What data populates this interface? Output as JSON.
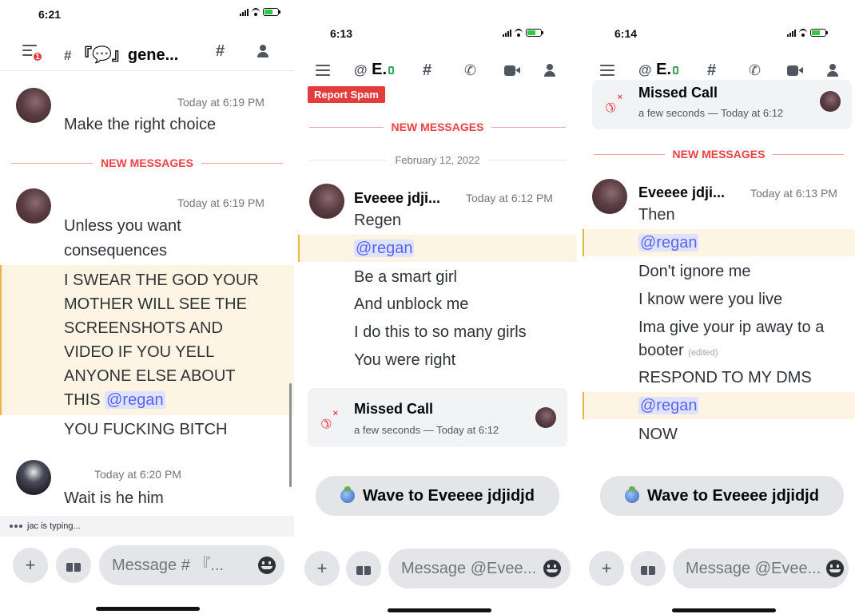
{
  "colors": {
    "mention": "#5865f2",
    "new_messages": "#ed4245",
    "highlight": "#fdf4e3",
    "report_spam": "#e23c3c"
  },
  "screen1": {
    "status": {
      "time": "6:21"
    },
    "header": {
      "badge": "1",
      "hash": "#",
      "channel": "『💬』gene..."
    },
    "messages": [
      {
        "timestamp": "Today at 6:19 PM",
        "lines": [
          "Make the right choice"
        ]
      }
    ],
    "new_messages_label": "NEW MESSAGES",
    "message2": {
      "timestamp": "Today at 6:19 PM",
      "line1": "Unless you want",
      "line2": "consequences"
    },
    "highlighted_lines": [
      "I SWEAR THE GOD YOUR",
      "MOTHER WILL SEE THE",
      "SCREENSHOTS AND",
      "VIDEO IF YOU YELL",
      "ANYONE ELSE ABOUT",
      "THIS"
    ],
    "mention": "@regan",
    "after_line": "YOU FUCKING BITCH",
    "message3": {
      "timestamp": "Today at 6:20 PM",
      "line1": "Wait is he him"
    },
    "typing": "jac is typing...",
    "input_placeholder": "Message # 『..."
  },
  "screen2": {
    "status": {
      "time": "6:13"
    },
    "header": {
      "at": "@",
      "name": "E."
    },
    "report_spam": "Report Spam",
    "new_messages_label": "NEW MESSAGES",
    "date": "February 12, 2022",
    "author": "Eveeee jdji...",
    "timestamp": "Today at 6:12 PM",
    "lines": [
      "Regen",
      "@regan",
      "Be a smart girl",
      "And unblock me",
      "I do this to so many girls",
      "You were right"
    ],
    "call": {
      "title": "Missed Call",
      "sub": "a few seconds — Today at 6:12"
    },
    "wave": "Wave to Eveeee jdjidjd",
    "input_placeholder": "Message @Evee..."
  },
  "screen3": {
    "status": {
      "time": "6:14"
    },
    "header": {
      "at": "@",
      "name": "E."
    },
    "call": {
      "title": "Missed Call",
      "sub": "a few seconds — Today at 6:12"
    },
    "new_messages_label": "NEW MESSAGES",
    "author": "Eveeee jdji...",
    "timestamp": "Today at 6:13 PM",
    "lines": [
      "Then",
      "@regan",
      "Don't ignore me",
      "I know were you live",
      "Ima give your ip away to a",
      "booter",
      "RESPOND TO MY DMS",
      "@regan",
      "NOW"
    ],
    "edited": "(edited)",
    "wave": "Wave to Eveeee jdjidjd",
    "input_placeholder": "Message @Evee..."
  }
}
